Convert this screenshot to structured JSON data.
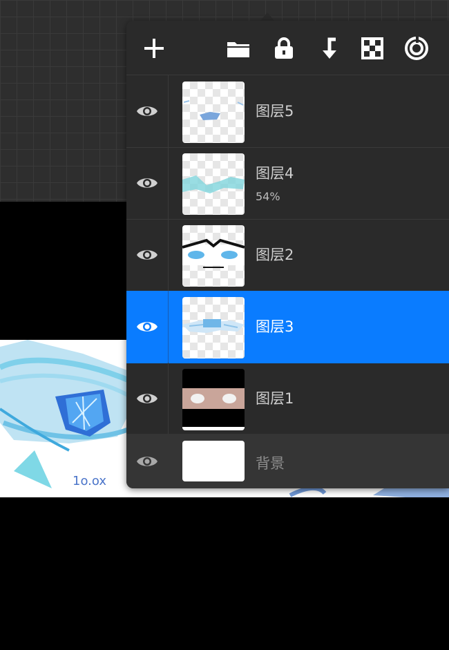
{
  "toolbar": {
    "buttons": [
      {
        "icon": "add-icon"
      },
      {
        "icon": "folder-icon"
      },
      {
        "icon": "lock-icon"
      },
      {
        "icon": "merge-down-icon"
      },
      {
        "icon": "alpha-lock-icon"
      },
      {
        "icon": "target-icon"
      }
    ]
  },
  "layers": [
    {
      "name": "图层5",
      "opacity": "",
      "selected": false,
      "visible": true
    },
    {
      "name": "图层4",
      "opacity": "54%",
      "selected": false,
      "visible": true
    },
    {
      "name": "图层2",
      "opacity": "",
      "selected": false,
      "visible": true
    },
    {
      "name": "图层3",
      "opacity": "",
      "selected": true,
      "visible": true
    },
    {
      "name": "图层1",
      "opacity": "",
      "selected": false,
      "visible": true
    }
  ],
  "background_layer": {
    "name": "背景",
    "visible": true
  },
  "colors": {
    "accent": "#0a7cff",
    "panel": "#2a2a2a",
    "canvas_bg": "#000000"
  }
}
